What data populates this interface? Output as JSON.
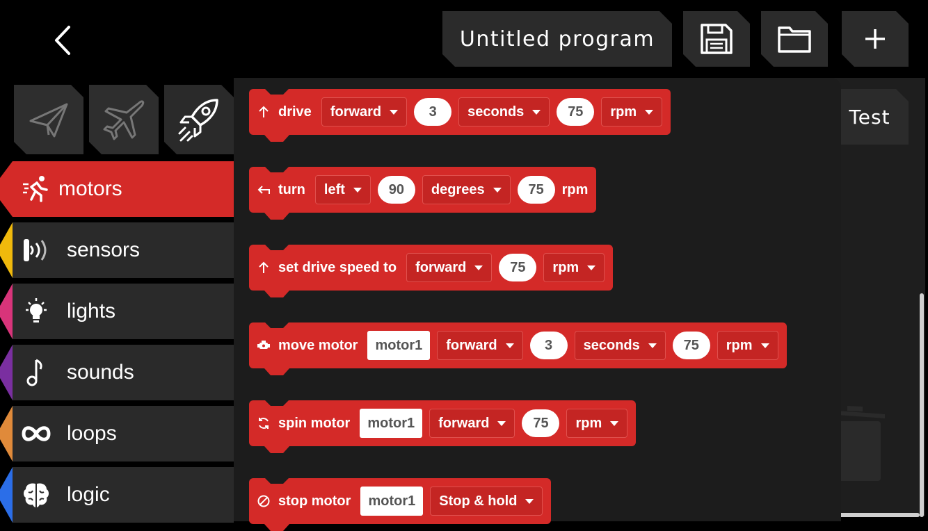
{
  "header": {
    "title": "Untitled program",
    "back_icon": "chevron-left-icon",
    "save_icon": "save-icon",
    "open_icon": "folder-icon",
    "new_icon": "plus-icon"
  },
  "modes": [
    {
      "icon": "paper-plane-icon"
    },
    {
      "icon": "airplane-icon"
    },
    {
      "icon": "rocket-icon",
      "selected": true
    }
  ],
  "categories": [
    {
      "label": "motors",
      "color": "#d42a28",
      "active": true
    },
    {
      "label": "sensors",
      "color": "#f0b90c"
    },
    {
      "label": "lights",
      "color": "#d8347a"
    },
    {
      "label": "sounds",
      "color": "#7a2fa0"
    },
    {
      "label": "loops",
      "color": "#e08a3a"
    },
    {
      "label": "logic",
      "color": "#2b6ee8"
    }
  ],
  "test_button": {
    "label": "Test"
  },
  "blocks": {
    "drive": {
      "label": "drive",
      "direction": "forward",
      "amount": "3",
      "unit": "seconds",
      "speed": "75",
      "speed_unit": "rpm"
    },
    "turn": {
      "label": "turn",
      "direction": "left",
      "amount": "90",
      "unit": "degrees",
      "speed": "75",
      "speed_unit": "rpm"
    },
    "set_speed": {
      "label": "set drive speed to",
      "direction": "forward",
      "speed": "75",
      "speed_unit": "rpm"
    },
    "move_motor": {
      "label": "move motor",
      "motor": "motor1",
      "direction": "forward",
      "amount": "3",
      "unit": "seconds",
      "speed": "75",
      "speed_unit": "rpm"
    },
    "spin_motor": {
      "label": "spin motor",
      "motor": "motor1",
      "direction": "forward",
      "speed": "75",
      "speed_unit": "rpm"
    },
    "stop_motor": {
      "label": "stop motor",
      "motor": "motor1",
      "mode": "Stop & hold"
    }
  },
  "colors": {
    "accent": "#d42a28",
    "panel": "#2a2a2a",
    "background": "#000000"
  }
}
